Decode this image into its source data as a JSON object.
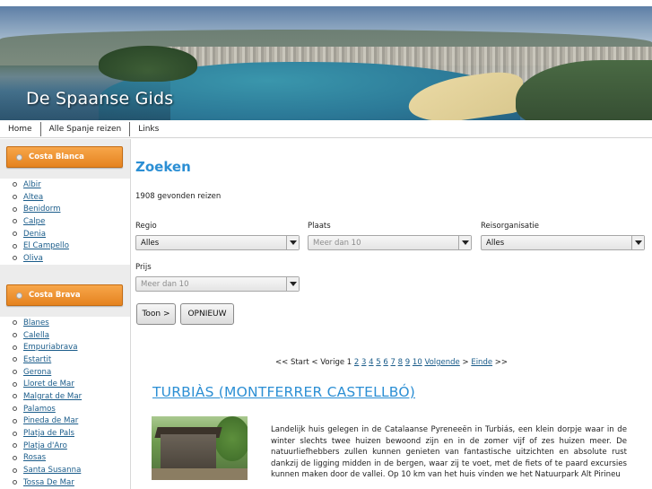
{
  "header": {
    "site_title": "De Spaanse Gids"
  },
  "topnav": {
    "items": [
      "Home",
      "Alle Spanje reizen",
      "Links"
    ]
  },
  "sidebar": {
    "regions": [
      {
        "label": "Costa Blanca",
        "places": [
          "Albir",
          "Altea",
          "Benidorm",
          "Calpe",
          "Denia",
          "El Campello",
          "Oliva"
        ]
      },
      {
        "label": "Costa Brava",
        "places": [
          "Blanes",
          "Calella",
          "Empuriabrava",
          "Estartit",
          "Gerona",
          "Lloret de Mar",
          "Malgrat de Mar",
          "Palamos",
          "Pineda de Mar",
          "Platja de Pals",
          "Platja d'Aro",
          "Rosas",
          "Santa Susanna",
          "Tossa De Mar"
        ]
      }
    ]
  },
  "main": {
    "title": "Zoeken",
    "result_count": "1908 gevonden reizen",
    "filters": {
      "regio": {
        "label": "Regio",
        "value": "Alles"
      },
      "plaats": {
        "label": "Plaats",
        "value": "Meer dan 10"
      },
      "reisorganisatie": {
        "label": "Reisorganisatie",
        "value": "Alles"
      },
      "prijs": {
        "label": "Prijs",
        "value": "Meer dan 10"
      }
    },
    "buttons": {
      "toon": "Toon >",
      "opnieuw": "OPNIEUW"
    },
    "pagination": {
      "start": "<< Start < Vorige",
      "current": "1",
      "pages": [
        "2",
        "3",
        "4",
        "5",
        "6",
        "7",
        "8",
        "9",
        "10"
      ],
      "next": "Volgende",
      "next_sep": ">",
      "end": "Einde",
      "end_sep": ">>"
    },
    "listing": {
      "title": "TURBIÀS (MONTFERRER CASTELLBÓ)",
      "description": "Landelijk huis gelegen in de Catalaanse Pyreneeën in Turbiás, een klein dorpje waar in de winter slechts twee huizen bewoond zijn en in de zomer vijf of zes huizen meer. De natuurliefhebbers zullen kunnen genieten van fantastische uitzichten en absolute rust dankzij de ligging midden in de bergen, waar zij te voet, met de fiets of te paard excursies kunnen maken door de vallei. Op 10 km van het huis vinden we het Natuurpark Alt Pirineu"
    }
  }
}
